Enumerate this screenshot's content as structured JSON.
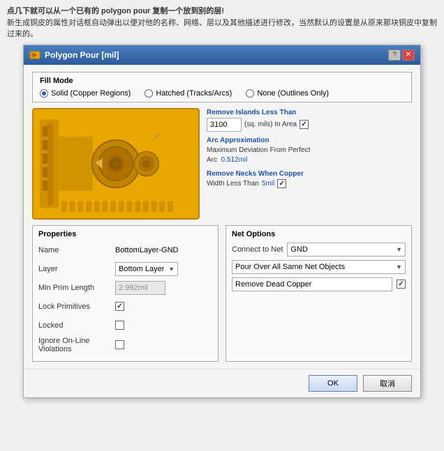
{
  "page": {
    "intro": {
      "line1_bold": "点几下就可以从一个已有的 polygon pour 复制一个放到别的层!",
      "line2": "新生成铜皮的属性对话框自动弹出以便对他的名称、网络、层以及其他描述进行修改，当然默认的设置是从原来那块铜皮中复制过来的。"
    },
    "dialog": {
      "title": "Polygon Pour [mil]",
      "help_btn": "?",
      "close_btn": "✕",
      "fill_mode": {
        "label": "Fill Mode",
        "options": [
          {
            "id": "solid",
            "label": "Solid (Copper Regions)",
            "selected": true
          },
          {
            "id": "hatched",
            "label": "Hatched (Tracks/Arcs)",
            "selected": false
          },
          {
            "id": "none",
            "label": "None (Outlines Only)",
            "selected": false
          }
        ]
      },
      "annotations": [
        {
          "title": "Remove Islands Less Than",
          "value": "3100",
          "unit": "(sq. mils) In Area",
          "checked": true
        },
        {
          "title": "Arc Approximation",
          "body_line1": "Maximum Deviation From Perfect",
          "body_line2": "Arc  0.512mil"
        },
        {
          "title": "Remove Necks When Copper",
          "body_line1": "Width Less Than",
          "value": "5mil",
          "checked": true
        }
      ],
      "properties": {
        "title": "Properties",
        "name_label": "Name",
        "name_value": "BottomLayer-GND",
        "layer_label": "Layer",
        "layer_value": "Bottom Layer",
        "min_prim_label": "Min Prim Length",
        "min_prim_value": "2.992mil",
        "lock_primitives_label": "Lock Primitives",
        "lock_primitives_checked": true,
        "locked_label": "Locked",
        "locked_checked": false,
        "ignore_violations_label": "Ignore On-Line Violations",
        "ignore_violations_checked": false
      },
      "net_options": {
        "title": "Net Options",
        "connect_label": "Connect to Net",
        "connect_value": "GND",
        "pour_over_label": "Pour Over All Same Net Objects",
        "remove_dead_label": "Remove Dead Copper",
        "remove_dead_checked": true
      },
      "footer": {
        "ok_label": "OK",
        "cancel_label": "取消"
      }
    }
  }
}
